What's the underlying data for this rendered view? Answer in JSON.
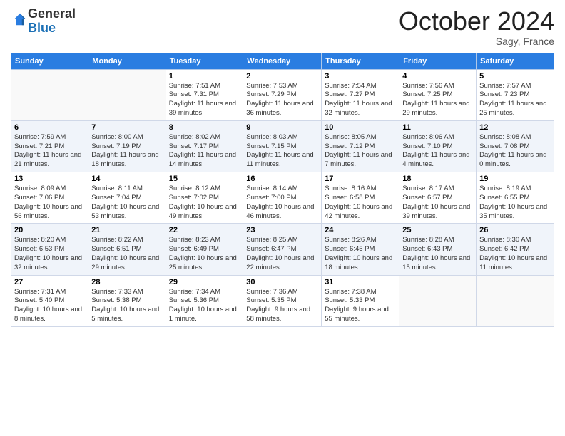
{
  "header": {
    "logo_general": "General",
    "logo_blue": "Blue",
    "month_title": "October 2024",
    "location": "Sagy, France"
  },
  "days_of_week": [
    "Sunday",
    "Monday",
    "Tuesday",
    "Wednesday",
    "Thursday",
    "Friday",
    "Saturday"
  ],
  "weeks": [
    [
      {
        "day": "",
        "sunrise": "",
        "sunset": "",
        "daylight": ""
      },
      {
        "day": "",
        "sunrise": "",
        "sunset": "",
        "daylight": ""
      },
      {
        "day": "1",
        "sunrise": "Sunrise: 7:51 AM",
        "sunset": "Sunset: 7:31 PM",
        "daylight": "Daylight: 11 hours and 39 minutes."
      },
      {
        "day": "2",
        "sunrise": "Sunrise: 7:53 AM",
        "sunset": "Sunset: 7:29 PM",
        "daylight": "Daylight: 11 hours and 36 minutes."
      },
      {
        "day": "3",
        "sunrise": "Sunrise: 7:54 AM",
        "sunset": "Sunset: 7:27 PM",
        "daylight": "Daylight: 11 hours and 32 minutes."
      },
      {
        "day": "4",
        "sunrise": "Sunrise: 7:56 AM",
        "sunset": "Sunset: 7:25 PM",
        "daylight": "Daylight: 11 hours and 29 minutes."
      },
      {
        "day": "5",
        "sunrise": "Sunrise: 7:57 AM",
        "sunset": "Sunset: 7:23 PM",
        "daylight": "Daylight: 11 hours and 25 minutes."
      }
    ],
    [
      {
        "day": "6",
        "sunrise": "Sunrise: 7:59 AM",
        "sunset": "Sunset: 7:21 PM",
        "daylight": "Daylight: 11 hours and 21 minutes."
      },
      {
        "day": "7",
        "sunrise": "Sunrise: 8:00 AM",
        "sunset": "Sunset: 7:19 PM",
        "daylight": "Daylight: 11 hours and 18 minutes."
      },
      {
        "day": "8",
        "sunrise": "Sunrise: 8:02 AM",
        "sunset": "Sunset: 7:17 PM",
        "daylight": "Daylight: 11 hours and 14 minutes."
      },
      {
        "day": "9",
        "sunrise": "Sunrise: 8:03 AM",
        "sunset": "Sunset: 7:15 PM",
        "daylight": "Daylight: 11 hours and 11 minutes."
      },
      {
        "day": "10",
        "sunrise": "Sunrise: 8:05 AM",
        "sunset": "Sunset: 7:12 PM",
        "daylight": "Daylight: 11 hours and 7 minutes."
      },
      {
        "day": "11",
        "sunrise": "Sunrise: 8:06 AM",
        "sunset": "Sunset: 7:10 PM",
        "daylight": "Daylight: 11 hours and 4 minutes."
      },
      {
        "day": "12",
        "sunrise": "Sunrise: 8:08 AM",
        "sunset": "Sunset: 7:08 PM",
        "daylight": "Daylight: 11 hours and 0 minutes."
      }
    ],
    [
      {
        "day": "13",
        "sunrise": "Sunrise: 8:09 AM",
        "sunset": "Sunset: 7:06 PM",
        "daylight": "Daylight: 10 hours and 56 minutes."
      },
      {
        "day": "14",
        "sunrise": "Sunrise: 8:11 AM",
        "sunset": "Sunset: 7:04 PM",
        "daylight": "Daylight: 10 hours and 53 minutes."
      },
      {
        "day": "15",
        "sunrise": "Sunrise: 8:12 AM",
        "sunset": "Sunset: 7:02 PM",
        "daylight": "Daylight: 10 hours and 49 minutes."
      },
      {
        "day": "16",
        "sunrise": "Sunrise: 8:14 AM",
        "sunset": "Sunset: 7:00 PM",
        "daylight": "Daylight: 10 hours and 46 minutes."
      },
      {
        "day": "17",
        "sunrise": "Sunrise: 8:16 AM",
        "sunset": "Sunset: 6:58 PM",
        "daylight": "Daylight: 10 hours and 42 minutes."
      },
      {
        "day": "18",
        "sunrise": "Sunrise: 8:17 AM",
        "sunset": "Sunset: 6:57 PM",
        "daylight": "Daylight: 10 hours and 39 minutes."
      },
      {
        "day": "19",
        "sunrise": "Sunrise: 8:19 AM",
        "sunset": "Sunset: 6:55 PM",
        "daylight": "Daylight: 10 hours and 35 minutes."
      }
    ],
    [
      {
        "day": "20",
        "sunrise": "Sunrise: 8:20 AM",
        "sunset": "Sunset: 6:53 PM",
        "daylight": "Daylight: 10 hours and 32 minutes."
      },
      {
        "day": "21",
        "sunrise": "Sunrise: 8:22 AM",
        "sunset": "Sunset: 6:51 PM",
        "daylight": "Daylight: 10 hours and 29 minutes."
      },
      {
        "day": "22",
        "sunrise": "Sunrise: 8:23 AM",
        "sunset": "Sunset: 6:49 PM",
        "daylight": "Daylight: 10 hours and 25 minutes."
      },
      {
        "day": "23",
        "sunrise": "Sunrise: 8:25 AM",
        "sunset": "Sunset: 6:47 PM",
        "daylight": "Daylight: 10 hours and 22 minutes."
      },
      {
        "day": "24",
        "sunrise": "Sunrise: 8:26 AM",
        "sunset": "Sunset: 6:45 PM",
        "daylight": "Daylight: 10 hours and 18 minutes."
      },
      {
        "day": "25",
        "sunrise": "Sunrise: 8:28 AM",
        "sunset": "Sunset: 6:43 PM",
        "daylight": "Daylight: 10 hours and 15 minutes."
      },
      {
        "day": "26",
        "sunrise": "Sunrise: 8:30 AM",
        "sunset": "Sunset: 6:42 PM",
        "daylight": "Daylight: 10 hours and 11 minutes."
      }
    ],
    [
      {
        "day": "27",
        "sunrise": "Sunrise: 7:31 AM",
        "sunset": "Sunset: 5:40 PM",
        "daylight": "Daylight: 10 hours and 8 minutes."
      },
      {
        "day": "28",
        "sunrise": "Sunrise: 7:33 AM",
        "sunset": "Sunset: 5:38 PM",
        "daylight": "Daylight: 10 hours and 5 minutes."
      },
      {
        "day": "29",
        "sunrise": "Sunrise: 7:34 AM",
        "sunset": "Sunset: 5:36 PM",
        "daylight": "Daylight: 10 hours and 1 minute."
      },
      {
        "day": "30",
        "sunrise": "Sunrise: 7:36 AM",
        "sunset": "Sunset: 5:35 PM",
        "daylight": "Daylight: 9 hours and 58 minutes."
      },
      {
        "day": "31",
        "sunrise": "Sunrise: 7:38 AM",
        "sunset": "Sunset: 5:33 PM",
        "daylight": "Daylight: 9 hours and 55 minutes."
      },
      {
        "day": "",
        "sunrise": "",
        "sunset": "",
        "daylight": ""
      },
      {
        "day": "",
        "sunrise": "",
        "sunset": "",
        "daylight": ""
      }
    ]
  ]
}
